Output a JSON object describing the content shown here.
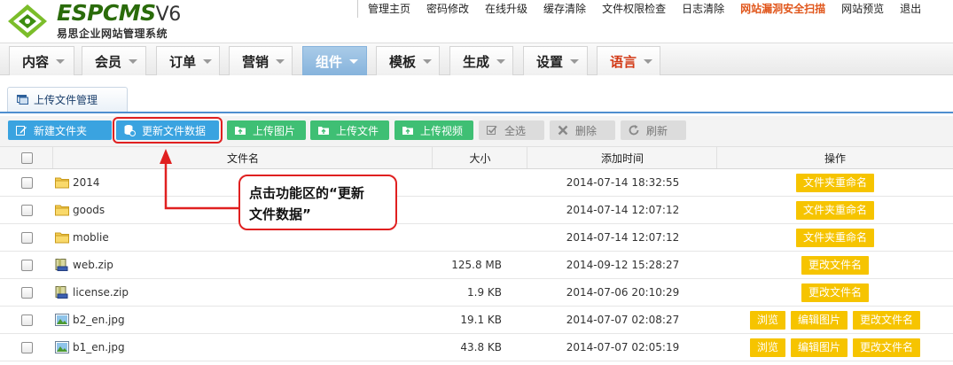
{
  "logo": {
    "word": "ESPCMS",
    "version": "V6",
    "subtitle": "易思企业网站管理系统"
  },
  "topnav": [
    {
      "label": "管理主页",
      "highlight": false
    },
    {
      "label": "密码修改",
      "highlight": false
    },
    {
      "label": "在线升级",
      "highlight": false
    },
    {
      "label": "缓存清除",
      "highlight": false
    },
    {
      "label": "文件权限检查",
      "highlight": false
    },
    {
      "label": "日志清除",
      "highlight": false
    },
    {
      "label": "网站漏洞安全扫描",
      "highlight": true
    },
    {
      "label": "网站预览",
      "highlight": false
    },
    {
      "label": "退出",
      "highlight": false
    }
  ],
  "mainmenu": [
    {
      "label": "内容",
      "active": false
    },
    {
      "label": "会员",
      "active": false
    },
    {
      "label": "订单",
      "active": false
    },
    {
      "label": "营销",
      "active": false
    },
    {
      "label": "组件",
      "active": true
    },
    {
      "label": "模板",
      "active": false
    },
    {
      "label": "生成",
      "active": false
    },
    {
      "label": "设置",
      "active": false
    },
    {
      "label": "语言",
      "active": false
    }
  ],
  "subtab": {
    "label": "上传文件管理"
  },
  "toolbar": {
    "new_folder": "新建文件夹",
    "update_data": "更新文件数据",
    "upload_image": "上传图片",
    "upload_file": "上传文件",
    "upload_video": "上传视频",
    "select_all": "全选",
    "delete": "删除",
    "refresh": "刷新"
  },
  "table": {
    "headers": {
      "name": "文件名",
      "size": "大小",
      "time": "添加时间",
      "ops": "操作"
    },
    "rows": [
      {
        "name": "2014",
        "type": "folder",
        "size": "",
        "time": "2014-07-14 18:32:55",
        "ops": [
          "文件夹重命名"
        ]
      },
      {
        "name": "goods",
        "type": "folder",
        "size": "",
        "time": "2014-07-14 12:07:12",
        "ops": [
          "文件夹重命名"
        ]
      },
      {
        "name": "moblie",
        "type": "folder",
        "size": "",
        "time": "2014-07-14 12:07:12",
        "ops": [
          "文件夹重命名"
        ]
      },
      {
        "name": "web.zip",
        "type": "zip",
        "size": "125.8 MB",
        "time": "2014-09-12 15:28:27",
        "ops": [
          "更改文件名"
        ]
      },
      {
        "name": "license.zip",
        "type": "zip",
        "size": "1.9 KB",
        "time": "2014-07-06 20:10:29",
        "ops": [
          "更改文件名"
        ]
      },
      {
        "name": "b2_en.jpg",
        "type": "image",
        "size": "19.1 KB",
        "time": "2014-07-07 02:08:27",
        "ops": [
          "浏览",
          "编辑图片",
          "更改文件名"
        ]
      },
      {
        "name": "b1_en.jpg",
        "type": "image",
        "size": "43.8 KB",
        "time": "2014-07-07 02:05:19",
        "ops": [
          "浏览",
          "编辑图片",
          "更改文件名"
        ]
      }
    ]
  },
  "callout": {
    "line1": "点击功能区的“更新",
    "line2": "文件数据”"
  },
  "colors": {
    "active_tab": "#86b3dc",
    "toolbar_blue": "#3aa3e0",
    "toolbar_green": "#3fbf74",
    "op_button": "#f6c400",
    "annotation_red": "#e02020"
  }
}
